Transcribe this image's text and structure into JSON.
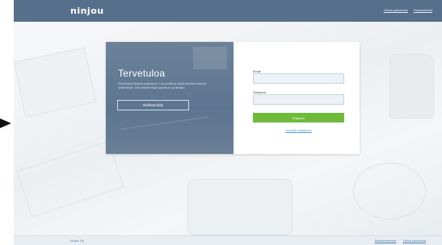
{
  "header": {
    "logo": "ninjou",
    "logo_sub": "i",
    "links": [
      "Tietoa palvelusta",
      "Palveluehdot"
    ]
  },
  "welcome": {
    "title": "Tervetuloa",
    "description": "Tervetuloa Ninjoun palveluun. Luo profiili ja löydä itsellesi sopivat työtehtävät. Voit rekisteröityä palveluun jo tänään.",
    "register_label": "Rekisteröidy"
  },
  "login": {
    "email_label": "Email",
    "password_label": "Salasana",
    "submit_label": "Kirjaudu",
    "forgot_label": "Unohdin salasanan"
  },
  "footer": {
    "company": "Ninjou Oy",
    "links": [
      "Rekisteriseloste",
      "Tietoa palvelusta"
    ]
  },
  "colors": {
    "header_bg": "#56708c",
    "accent_green": "#6fba3c",
    "link_blue": "#4a9ac9"
  }
}
